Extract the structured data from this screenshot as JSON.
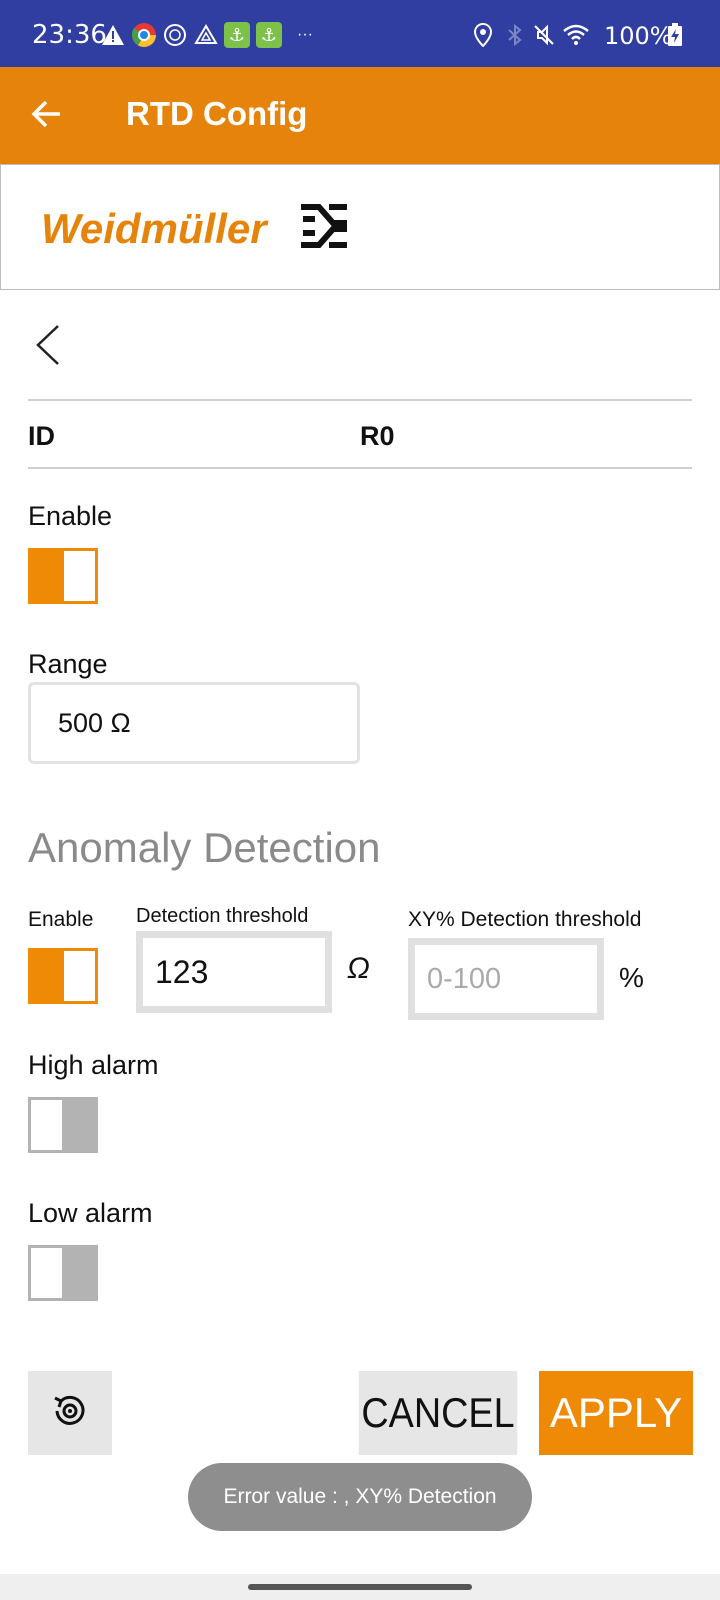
{
  "status_bar": {
    "time": "23:36",
    "battery": "100%",
    "more": "···",
    "icons": [
      "alert-icon",
      "chrome-icon",
      "vpn-icon",
      "drive-icon",
      "anchor-icon",
      "anchor-icon",
      "location-icon",
      "bluetooth-icon",
      "mute-icon",
      "wifi-icon",
      "battery-icon"
    ],
    "bg_color": "#2f3ea0"
  },
  "app_bar": {
    "title": "RTD Config",
    "back_icon": "arrow-left-icon",
    "bg_color": "#e5830a"
  },
  "logo": {
    "brand": "Weidmüller",
    "mark": "weidmuller-logo-mark"
  },
  "header_row": {
    "label": "ID",
    "value": "R0"
  },
  "enable": {
    "label": "Enable",
    "on": true
  },
  "range": {
    "label": "Range",
    "value": "500 Ω"
  },
  "anomaly": {
    "title": "Anomaly Detection",
    "enable_label": "Enable",
    "enable_on": true,
    "detection_threshold_label": "Detection threshold",
    "detection_threshold_value": "123",
    "detection_threshold_unit": "Ω",
    "xy_threshold_label": "XY% Detection threshold",
    "xy_threshold_placeholder": "0-100",
    "xy_threshold_unit": "%"
  },
  "high_alarm": {
    "label": "High alarm",
    "on": false
  },
  "low_alarm": {
    "label": "Low alarm",
    "on": false
  },
  "actions": {
    "reset_icon": "reset-settings-icon",
    "cancel": "CANCEL",
    "apply": "APPLY"
  },
  "toast": "Error value : , XY% Detection",
  "accent_color": "#ee8a06"
}
